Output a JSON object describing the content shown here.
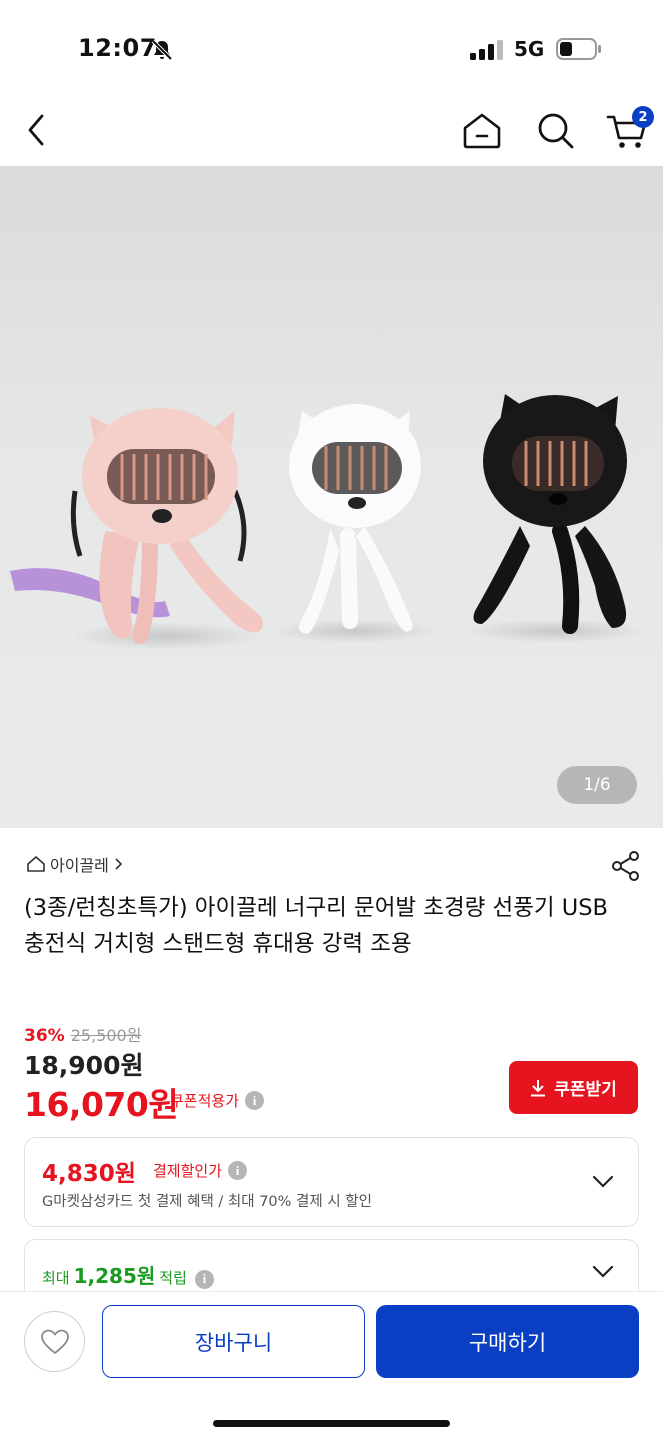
{
  "status_bar": {
    "time": "12:07",
    "network": "5G",
    "icons": [
      "bell-muted-icon",
      "signal-icon",
      "battery-icon"
    ]
  },
  "nav": {
    "icons": [
      "back-icon",
      "home-icon",
      "search-icon",
      "cart-icon"
    ],
    "cart_count": "2",
    "accent_color": "#0a3fc4"
  },
  "gallery": {
    "counter": "1/6"
  },
  "product": {
    "brand": "아이끌레",
    "title": "(3종/런칭초특가) 아이끌레 너구리 문어발 초경량 선풍기 USB 충전식 거치형 스탠드형 휴대용 강력 조용",
    "discount_rate": "36%",
    "original_price": "25,500원",
    "sale_price": "18,900원",
    "coupon_price": "16,070원",
    "coupon_applied_label": "쿠폰적용가",
    "coupon_button_label": "쿠폰받기",
    "price_color": "#e5141e"
  },
  "payment_discount": {
    "amount": "4,830원",
    "label": "결제할인가",
    "description": "G마켓삼성카드 첫 결제 혜택 / 최대 70% 결제 시 할인"
  },
  "points": {
    "prefix": "최대",
    "amount": "1,285원",
    "suffix": "적립",
    "color": "#1a9b1f"
  },
  "bottom_bar": {
    "cart_label": "장바구니",
    "buy_label": "구매하기"
  }
}
